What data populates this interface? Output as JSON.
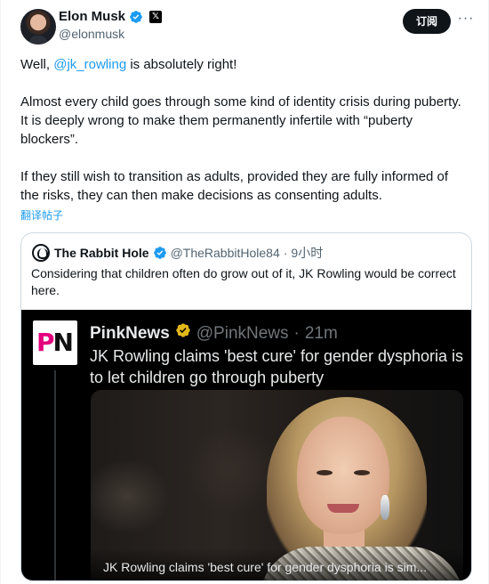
{
  "post": {
    "author": {
      "display_name": "Elon Musk",
      "handle": "@elonmusk",
      "badge_label": "𝕏"
    },
    "subscribe_label": "订阅",
    "more_label": "···",
    "text": {
      "p1_before": "Well, ",
      "p1_mention": "@jk_rowling",
      "p1_after": " is absolutely right!",
      "p2": "Almost every child goes through some kind of identity crisis during puberty. It is deeply wrong to make them permanently infertile with “puberty blockers”.",
      "p3": "If they still wish to transition as adults, provided they are fully informed of the risks, they can then make decisions as consenting adults."
    },
    "translate_label": "翻译帖子"
  },
  "quote": {
    "author": {
      "display_name": "The Rabbit Hole",
      "handle": "@TheRabbitHole84",
      "separator": "·",
      "time": "9小时"
    },
    "text": "Considering that children often do grow out of it, JK Rowling would be correct here.",
    "media": {
      "logo_text_p": "P",
      "logo_text_n": "N",
      "inner_author": {
        "display_name": "PinkNews",
        "handle": "@PinkNews",
        "separator": "·",
        "time": "21m"
      },
      "inner_text": "JK Rowling claims 'best cure' for gender dysphoria is to let children go through puberty",
      "caption": "JK Rowling claims 'best cure' for gender dysphoria is sim..."
    }
  },
  "colors": {
    "link": "#1d9bf0",
    "verified_blue": "#1d9bf0",
    "verified_gold": "#e2b719",
    "pinknews_pink": "#e4007c"
  },
  "icons": [
    "verified-badge-icon",
    "x-logo-icon",
    "more-icon",
    "rabbit-hole-avatar-icon",
    "gold-verified-badge-icon",
    "pinknews-logo-icon"
  ]
}
